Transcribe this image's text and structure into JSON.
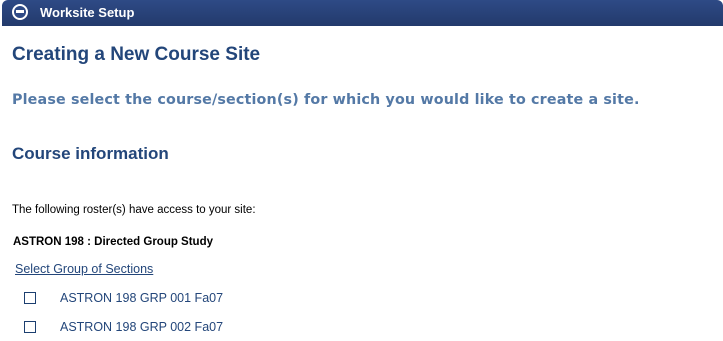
{
  "header": {
    "title": "Worksite Setup",
    "icon": "reset-icon"
  },
  "page": {
    "title": "Creating a New Course Site",
    "instruction": "Please select the course/section(s) for which you would like to create a site."
  },
  "course_info": {
    "heading": "Course information",
    "roster_note": "The following roster(s) have access to your site:",
    "course_name": "ASTRON 198 : Directed Group Study",
    "select_group_link": "Select Group of Sections",
    "sections": [
      {
        "label": "ASTRON 198 GRP 001 Fa07",
        "checked": false
      },
      {
        "label": "ASTRON 198 GRP 002 Fa07",
        "checked": false
      }
    ]
  },
  "colors": {
    "header_bg": "#2e4a86",
    "heading": "#23467a",
    "instruction": "#5479a6",
    "link": "#23467a"
  }
}
